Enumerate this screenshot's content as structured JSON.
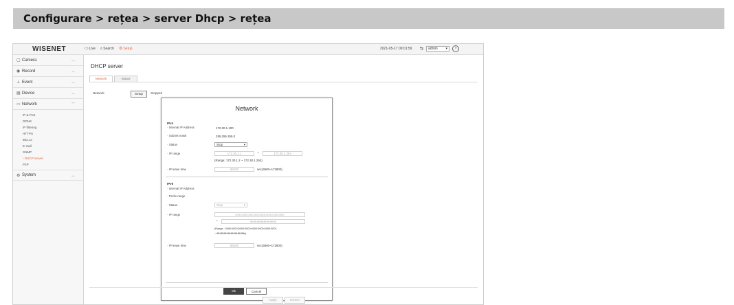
{
  "doc_header": "Configurare > rețea > server Dhcp > rețea",
  "app": {
    "logo": "WISENET",
    "nav": [
      {
        "label": "Live",
        "icon": "monitor-icon"
      },
      {
        "label": "Search",
        "icon": "search-icon"
      },
      {
        "label": "Setup",
        "icon": "gear-icon"
      }
    ],
    "datetime": "2021-05-17 09:01:59",
    "user": "admin",
    "help": "?",
    "accent_color": "#e5643a"
  },
  "sidebar": {
    "categories": [
      {
        "label": "Camera",
        "icon": "camera-icon"
      },
      {
        "label": "Record",
        "icon": "record-icon"
      },
      {
        "label": "Event",
        "icon": "event-icon"
      },
      {
        "label": "Device",
        "icon": "device-icon"
      },
      {
        "label": "Network",
        "icon": "network-icon"
      }
    ],
    "network_items": [
      "IP & Port",
      "DDNS",
      "IP filtering",
      "HTTPS",
      "802.1x",
      "E-mail",
      "SNMP",
      "DHCP server",
      "P2P"
    ],
    "active_item": "DHCP server",
    "system": {
      "label": "System",
      "icon": "system-icon"
    }
  },
  "main": {
    "title": "DHCP server",
    "tabs": [
      "Network",
      "Status"
    ],
    "active_tab": "Network",
    "network_label": "Network",
    "setup_button": "Setup",
    "state": "Stopped",
    "apply_button": "Apply",
    "revert_button": "Revert"
  },
  "dialog": {
    "title": "Network",
    "ipv4": {
      "header": "IPv4",
      "internal_ip_label": "Internal IP Address",
      "internal_ip_value": "172.30.1.100",
      "subnet_label": "Subnet mask",
      "subnet_value": "255.255.255.0",
      "status_label": "Status",
      "status_value": "Stop",
      "ip_range_label": "IP range",
      "ip_range_start": "172.30.1.1",
      "ip_range_end": "172.30.1.254",
      "range_hint": "(Range: 172.30.1.2 ~ 172.30.1.254)",
      "lease_label": "IP lease time",
      "lease_value": "86400",
      "lease_unit": "sec(3600~172800)"
    },
    "ipv6": {
      "header": "IPv6",
      "internal_ip_label": "Internal IP Address",
      "prefix_label": "Prefix range",
      "status_label": "Status",
      "status_value": "Stop",
      "ip_range_label": "IP range",
      "ip_range_start": "0000:0000:0000:0000:0000:0000:0000:0000",
      "ip_range_end": "ffff:ffff:ffff:ffff:ffff:ffff:ffff:ffff",
      "range_hint_1": "(Range : 0000:0000:0000:0000:0000:0000:0000:0001",
      "range_hint_2": "~ ffff:ffff:ffff:ffff:ffff:ffff:ffff:ffffe)",
      "lease_label": "IP lease time",
      "lease_value": "86400",
      "lease_unit": "sec(3600~172800)"
    },
    "ok_button": "Ok",
    "cancel_button": "Cancel"
  }
}
